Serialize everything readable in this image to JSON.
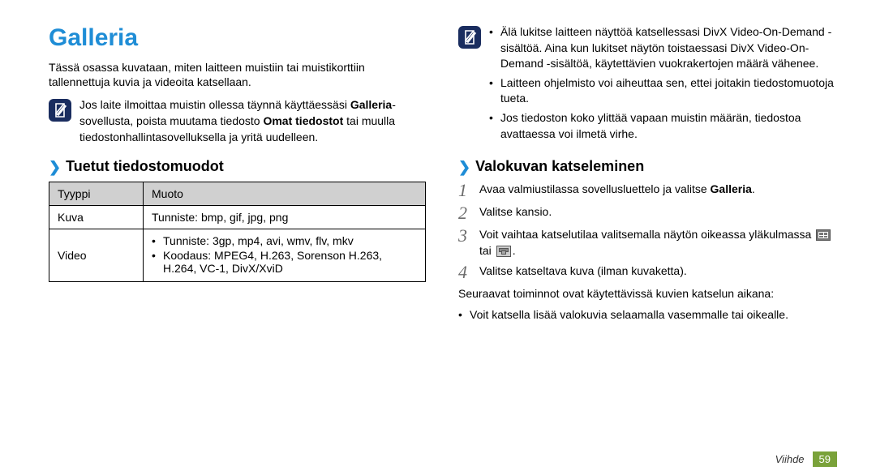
{
  "left": {
    "title": "Galleria",
    "intro": "Tässä osassa kuvataan, miten laitteen muistiin tai muistikorttiin tallennettuja kuvia ja videoita katsellaan.",
    "note": {
      "prefix": "Jos laite ilmoittaa muistin ollessa täynnä käyttäessäsi ",
      "bold1": "Galleria",
      "mid1": "-sovellusta, poista muutama tiedosto ",
      "bold2": "Omat tiedostot",
      "suffix": " tai muulla tiedostonhallintasovelluksella ja yritä uudelleen."
    },
    "subheading": "Tuetut tiedostomuodot",
    "table": {
      "headers": [
        "Tyyppi",
        "Muoto"
      ],
      "rows": [
        {
          "type": "Kuva",
          "fmt_single": "Tunniste: bmp, gif, jpg, png"
        },
        {
          "type": "Video",
          "fmt_list": [
            "Tunniste: 3gp, mp4, avi, wmv, flv, mkv",
            "Koodaus: MPEG4, H.263, Sorenson H.263, H.264, VC-1, DivX/XviD"
          ]
        }
      ]
    }
  },
  "right": {
    "note_items": [
      "Älä lukitse laitteen näyttöä katsellessasi DivX Video-On-Demand -sisältöä. Aina kun lukitset näytön toistaessasi DivX Video-On-Demand -sisältöä, käytettävien vuokrakertojen määrä vähenee.",
      "Laitteen ohjelmisto voi aiheuttaa sen, ettei joitakin tiedostomuotoja tueta.",
      "Jos tiedoston koko ylittää vapaan muistin määrän, tiedostoa avattaessa voi ilmetä virhe."
    ],
    "subheading": "Valokuvan katseleminen",
    "steps": {
      "s1_a": "Avaa valmiustilassa sovellusluettelo ja valitse ",
      "s1_b": "Galleria",
      "s1_c": ".",
      "s2": "Valitse kansio.",
      "s3_a": "Voit vaihtaa katselutilaa valitsemalla näytön oikeassa yläkulmassa ",
      "s3_mid": " tai ",
      "s3_end": ".",
      "s4": "Valitse katseltava kuva (ilman kuvaketta)."
    },
    "after_steps": "Seuraavat toiminnot ovat käytettävissä kuvien katselun aikana:",
    "bullets": [
      "Voit katsella lisää valokuvia selaamalla vasemmalle tai oikealle."
    ]
  },
  "footer": {
    "category": "Viihde",
    "page": "59"
  }
}
